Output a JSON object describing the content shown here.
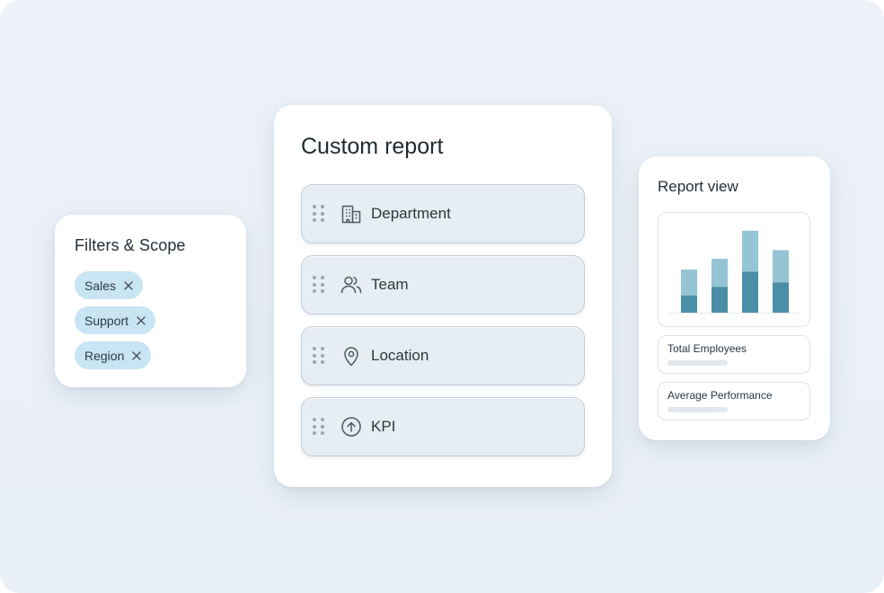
{
  "filters": {
    "title": "Filters & Scope",
    "chips": [
      {
        "label": "Sales",
        "remove_icon": "close-icon"
      },
      {
        "label": "Support",
        "remove_icon": "close-icon"
      },
      {
        "label": "Region",
        "remove_icon": "close-icon"
      }
    ]
  },
  "report": {
    "title": "Custom report",
    "fields": [
      {
        "label": "Department",
        "icon": "building-icon"
      },
      {
        "label": "Team",
        "icon": "users-icon"
      },
      {
        "label": "Location",
        "icon": "map-pin-icon"
      },
      {
        "label": "KPI",
        "icon": "arrow-up-circle-icon"
      }
    ]
  },
  "view": {
    "title": "Report view",
    "chart_data": {
      "type": "bar",
      "stacked": true,
      "bars": [
        {
          "bottom": 0.4,
          "top": 0.6
        },
        {
          "bottom": 0.6,
          "top": 0.65
        },
        {
          "bottom": 0.95,
          "top": 0.95
        },
        {
          "bottom": 0.7,
          "top": 0.75
        }
      ],
      "colors": {
        "bottom": "#4b8ea7",
        "top": "#95c4d4"
      }
    },
    "stats": [
      {
        "label": "Total Employees"
      },
      {
        "label": "Average Performance"
      }
    ]
  },
  "colors": {
    "background": "#ebf1f7",
    "chip": "#c9e5f3",
    "field": "#e6edf3",
    "accent": "#4b8ea7"
  }
}
